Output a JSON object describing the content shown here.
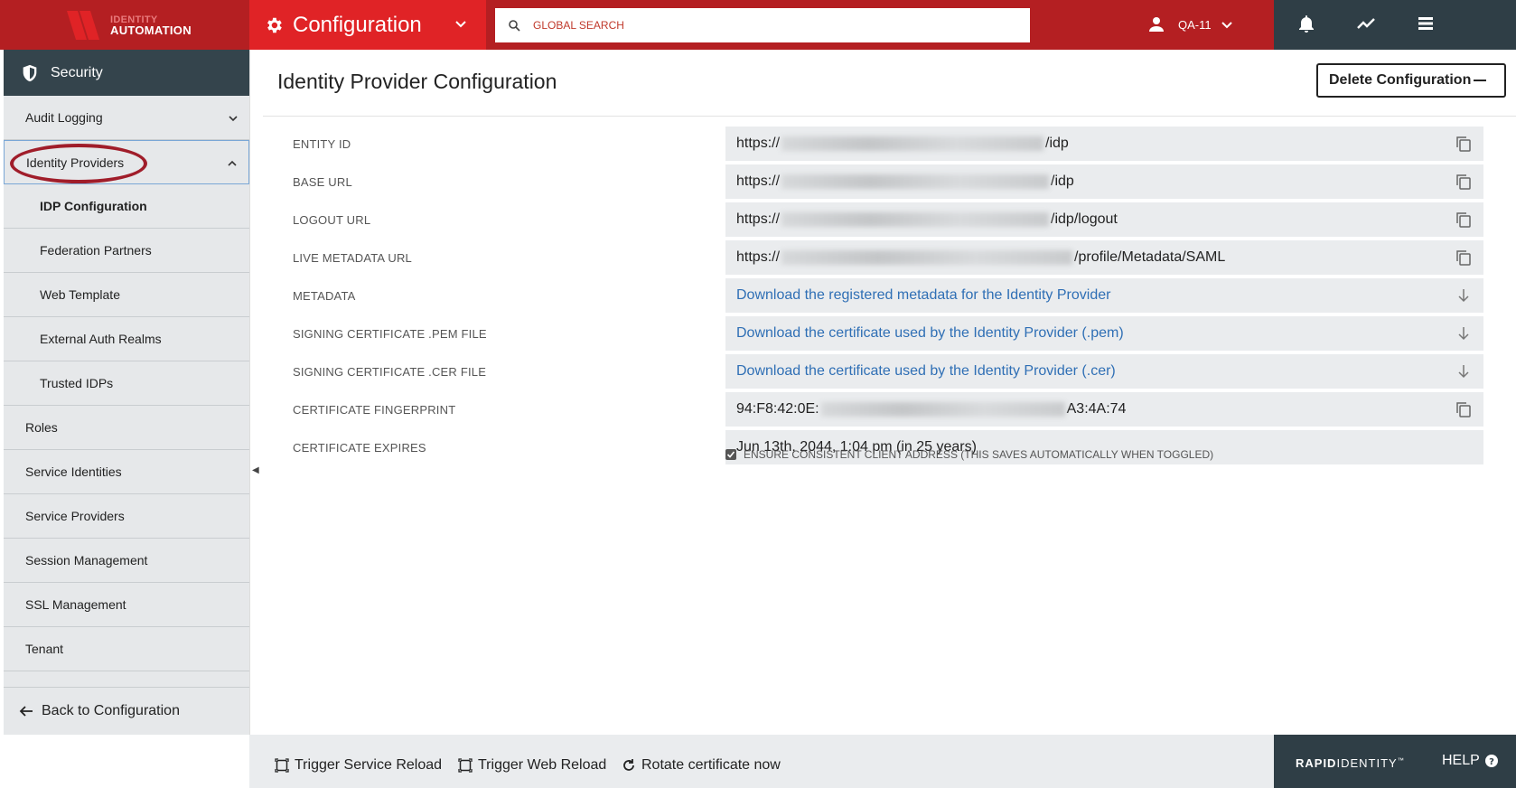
{
  "brand": {
    "line1": "IDENTITY",
    "line2": "AUTOMATION"
  },
  "header": {
    "module_title": "Configuration",
    "search_placeholder": "GLOBAL SEARCH",
    "user": "QA-11"
  },
  "sidebar": {
    "section": "Security",
    "items": [
      {
        "label": "Audit Logging",
        "type": "top",
        "chevron": "down"
      },
      {
        "label": "Identity Providers",
        "type": "top",
        "chevron": "up",
        "open": true
      },
      {
        "label": "IDP Configuration",
        "type": "sub",
        "active": true
      },
      {
        "label": "Federation Partners",
        "type": "sub"
      },
      {
        "label": "Web Template",
        "type": "sub"
      },
      {
        "label": "External Auth Realms",
        "type": "sub"
      },
      {
        "label": "Trusted IDPs",
        "type": "sub"
      },
      {
        "label": "Roles",
        "type": "top"
      },
      {
        "label": "Service Identities",
        "type": "top"
      },
      {
        "label": "Service Providers",
        "type": "top"
      },
      {
        "label": "Session Management",
        "type": "top"
      },
      {
        "label": "SSL Management",
        "type": "top"
      },
      {
        "label": "Tenant",
        "type": "top"
      }
    ],
    "back": "Back to Configuration"
  },
  "main": {
    "title": "Identity Provider Configuration",
    "delete_label": "Delete Configuration",
    "fields": [
      {
        "label": "ENTITY ID",
        "prefix": "https://",
        "suffix": "/idp",
        "redacted": true,
        "action": "copy-icon"
      },
      {
        "label": "BASE URL",
        "prefix": "https://",
        "suffix": "/idp",
        "redacted": true,
        "action": "copy-icon"
      },
      {
        "label": "LOGOUT URL",
        "prefix": "https://",
        "suffix": "/idp/logout",
        "redacted": true,
        "action": "copy-icon"
      },
      {
        "label": "LIVE METADATA URL",
        "prefix": "https://",
        "suffix": "/profile/Metadata/SAML",
        "redacted": true,
        "action": "copy-icon"
      },
      {
        "label": "METADATA",
        "link": "Download the registered metadata for the Identity Provider",
        "action": "download-icon"
      },
      {
        "label": "SIGNING CERTIFICATE .PEM FILE",
        "link": "Download the certificate used by the Identity Provider (.pem)",
        "action": "download-icon"
      },
      {
        "label": "SIGNING CERTIFICATE .CER FILE",
        "link": "Download the certificate used by the Identity Provider (.cer)",
        "action": "download-icon"
      },
      {
        "label": "CERTIFICATE FINGERPRINT",
        "prefix": "94:F8:42:0E:",
        "suffix": "A3:4A:74",
        "redacted": true,
        "action": "copy-icon"
      },
      {
        "label": "CERTIFICATE EXPIRES",
        "text": "Jun 13th, 2044, 1:04 pm (in 25 years)"
      }
    ],
    "checkbox_label": "ENSURE CONSISTENT CLIENT ADDRESS (THIS SAVES AUTOMATICALLY WHEN TOGGLED)",
    "checkbox_checked": true
  },
  "footer": {
    "buttons": [
      "Trigger Service Reload",
      "Trigger Web Reload",
      "Rotate certificate now"
    ],
    "brand_bold": "RAPID",
    "brand_light": "IDENTITY",
    "brand_tm": "™",
    "help": "HELP"
  }
}
